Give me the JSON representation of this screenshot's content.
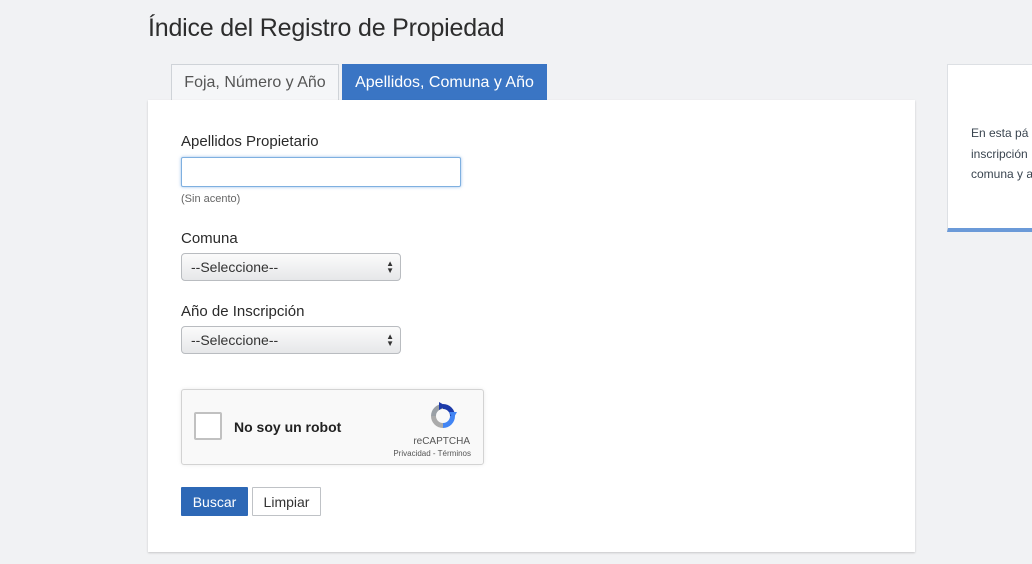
{
  "page": {
    "title": "Índice del Registro de Propiedad"
  },
  "tabs": [
    {
      "label": "Foja, Número y Año",
      "active": false
    },
    {
      "label": "Apellidos, Comuna y Año",
      "active": true
    }
  ],
  "form": {
    "surname_label": "Apellidos Propietario",
    "surname_value": "",
    "surname_hint": "(Sin acento)",
    "comuna_label": "Comuna",
    "comuna_selected": "--Seleccione--",
    "year_label": "Año de Inscripción",
    "year_selected": "--Seleccione--"
  },
  "captcha": {
    "label": "No soy un robot",
    "brand": "reCAPTCHA",
    "links": "Privacidad - Términos",
    "icon": "recaptcha-logo"
  },
  "buttons": {
    "search": "Buscar",
    "clear": "Limpiar"
  },
  "side_panel": {
    "lines": [
      "En esta pá",
      "inscripción",
      "comuna y a"
    ]
  },
  "colors": {
    "accent": "#3a75c4",
    "primary_button": "#2d68b6",
    "background": "#f1f2f4"
  }
}
